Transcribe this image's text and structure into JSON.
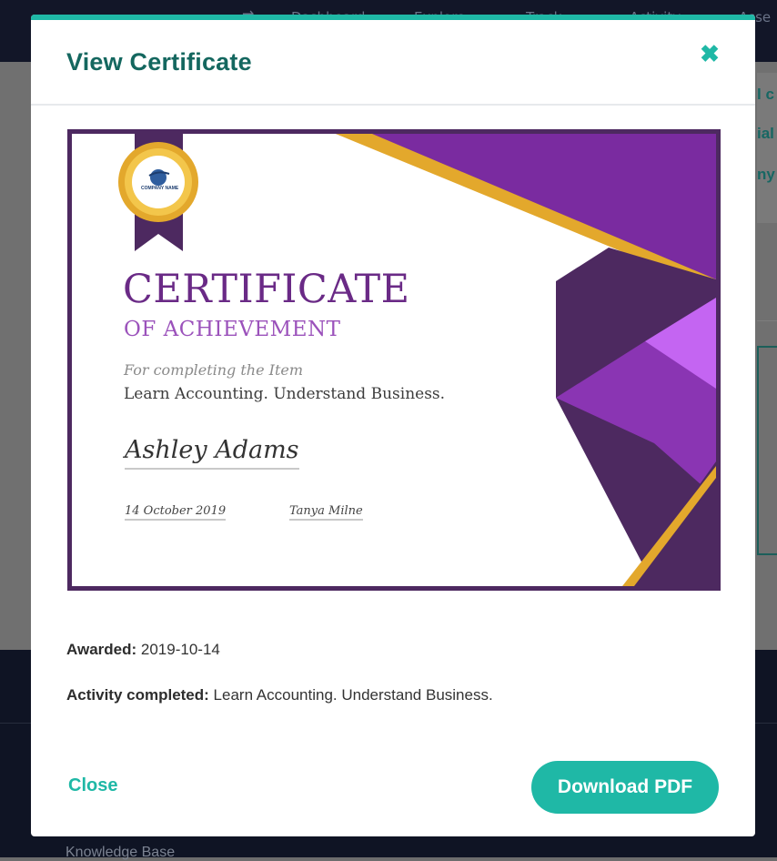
{
  "background": {
    "nav_labels": [
      "Dashboard",
      "Explore",
      "Track",
      "Activity",
      "Asse"
    ],
    "card_fragments": [
      "l c",
      "ial",
      "ny"
    ],
    "footer_link": "Knowledge Base"
  },
  "modal": {
    "title": "View Certificate",
    "close_icon": "close-icon",
    "certificate": {
      "seal_text": "COMPANY NAME",
      "title": "CERTIFICATE",
      "subtitle": "OF ACHIEVEMENT",
      "for_text": "For completing the Item",
      "item": "Learn Accounting. Understand Business.",
      "recipient": "Ashley Adams",
      "date": "14 October 2019",
      "signer": "Tanya Milne"
    },
    "details": {
      "awarded_label": "Awarded:",
      "awarded_value": "2019-10-14",
      "activity_label": "Activity completed:",
      "activity_value": "Learn Accounting. Understand Business."
    },
    "close_label": "Close",
    "download_label": "Download PDF"
  },
  "colors": {
    "accent": "#1fb8a6",
    "title": "#14675f",
    "cert_purple": "#6a2a86",
    "cert_gold": "#e3a82c"
  }
}
